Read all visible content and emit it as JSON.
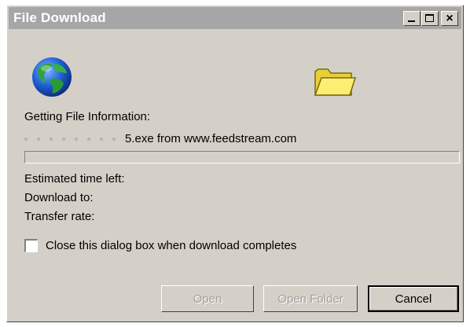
{
  "window": {
    "title": "File Download"
  },
  "titlebar_buttons": {
    "minimize": "_",
    "maximize": "□",
    "close": "×"
  },
  "status": {
    "getting_info": "Getting File Information:",
    "file_text": "5.exe from www.feedstream.com",
    "progress_fraction": 0
  },
  "details": {
    "estimated_time_label": "Estimated time left:",
    "download_to_label": "Download to:",
    "transfer_rate_label": "Transfer rate:"
  },
  "options": {
    "close_when_done_label": "Close this dialog box when download completes",
    "close_when_done_checked": false
  },
  "buttons": {
    "open_label": "Open",
    "open_folder_label": "Open Folder",
    "cancel_label": "Cancel"
  },
  "icons": {
    "globe": "globe-icon",
    "folder": "folder-icon"
  },
  "colors": {
    "titlebar": "#a6a6a6",
    "window_bg": "#d4d0c8",
    "progress_fill": "#0a246a"
  }
}
